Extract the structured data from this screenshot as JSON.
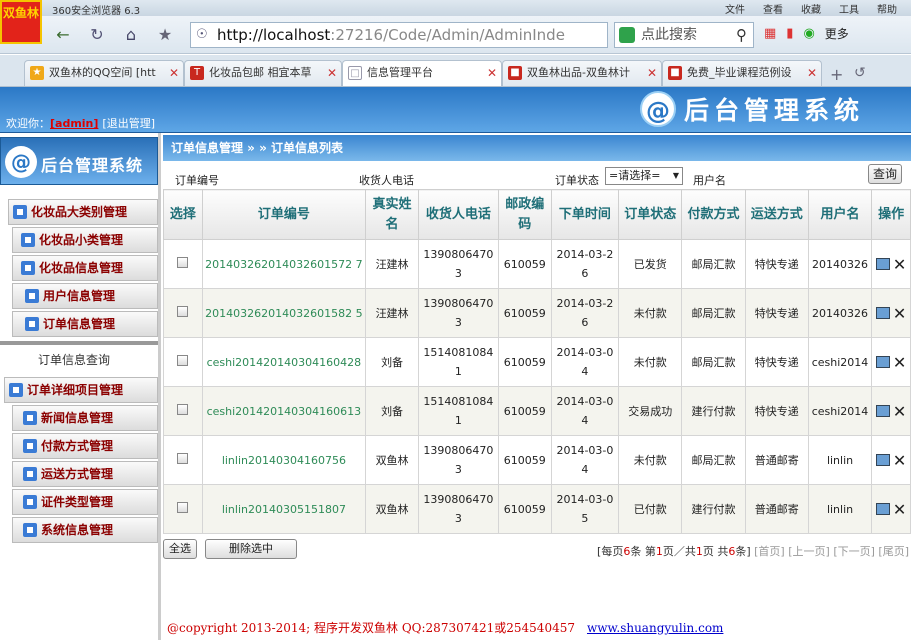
{
  "browser": {
    "logo": "双鱼林",
    "title": "360安全浏览器 6.3",
    "menu": [
      "文件",
      "查看",
      "收藏",
      "工具",
      "帮助"
    ],
    "url_host": "http://localhost",
    "url_path": ":27216/Code/Admin/AdminInde",
    "search_placeholder": "点此搜索",
    "more": "更多"
  },
  "tabs": [
    {
      "label": "双鱼林的QQ空间 [htt",
      "color": "#f0a818"
    },
    {
      "label": "化妆品包邮 相宜本草",
      "color": "#c8281e"
    },
    {
      "label": "信息管理平台",
      "color": "#7a8aa0"
    },
    {
      "label": "双鱼林出品-双鱼林计",
      "color": "#c8281e"
    },
    {
      "label": "免费_毕业课程范例设",
      "color": "#c8281e"
    }
  ],
  "header": {
    "welcome": "欢迎你：",
    "user": "[admin]",
    "logout": "[退出管理]",
    "title": "后台管理系统",
    "at_symbol": "@"
  },
  "sidebar": {
    "title": "后台管理系统",
    "items_top": [
      "化妆品大类别管理",
      "化妆品小类管理",
      "化妆品信息管理",
      "用户信息管理",
      "订单信息管理"
    ],
    "sub_item": "订单信息查询",
    "items_bottom": [
      "订单详细项目管理",
      "新闻信息管理",
      "付款方式管理",
      "运送方式管理",
      "证件类型管理",
      "系统信息管理"
    ]
  },
  "crumb": "订单信息管理 » » 订单信息列表",
  "filter": {
    "order_no_label": "订单编号",
    "phone_label": "收货人电话",
    "status_label": "订单状态",
    "status_value": "=请选择=",
    "username_label": "用户名",
    "query_button": "查询"
  },
  "table": {
    "headers": [
      "选择",
      "订单编号",
      "真实姓名",
      "收货人电话",
      "邮政编码",
      "下单时间",
      "订单状态",
      "付款方式",
      "运送方式",
      "用户名",
      "操作"
    ],
    "rows": [
      [
        "201403262014032601572 7",
        "汪建林",
        "13908064703",
        "610059",
        "2014-03-26",
        "已发货",
        "邮局汇款",
        "特快专递",
        "20140326"
      ],
      [
        "201403262014032601582 5",
        "汪建林",
        "13908064703",
        "610059",
        "2014-03-26",
        "未付款",
        "邮局汇款",
        "特快专递",
        "20140326"
      ],
      [
        "ceshi201420140304160428",
        "刘备",
        "15140810841",
        "610059",
        "2014-03-04",
        "未付款",
        "邮局汇款",
        "特快专递",
        "ceshi2014"
      ],
      [
        "ceshi201420140304160613",
        "刘备",
        "15140810841",
        "610059",
        "2014-03-04",
        "交易成功",
        "建行付款",
        "特快专递",
        "ceshi2014"
      ],
      [
        "linlin20140304160756",
        "双鱼林",
        "13908064703",
        "610059",
        "2014-03-04",
        "未付款",
        "邮局汇款",
        "普通邮寄",
        "linlin"
      ],
      [
        "linlin20140305151807",
        "双鱼林",
        "13908064703",
        "610059",
        "2014-03-05",
        "已付款",
        "建行付款",
        "普通邮寄",
        "linlin"
      ]
    ]
  },
  "actions": {
    "select_all": "全选",
    "delete_selected": "删除选中"
  },
  "pager": {
    "prefix": "[每页",
    "per_page": "6",
    "mid1": "条 第",
    "page": "1",
    "mid2": "页／共",
    "total_pages": "1",
    "mid3": "页 共",
    "total": "6",
    "suffix": "条]",
    "first": "[首页]",
    "prev": "[上一页]",
    "next": "[下一页]",
    "last": "[尾页]"
  },
  "footer": {
    "text": "@copyright 2013-2014; 程序开发双鱼林  QQ:287307421或254540457",
    "link": "www.shuangyulin.com"
  }
}
